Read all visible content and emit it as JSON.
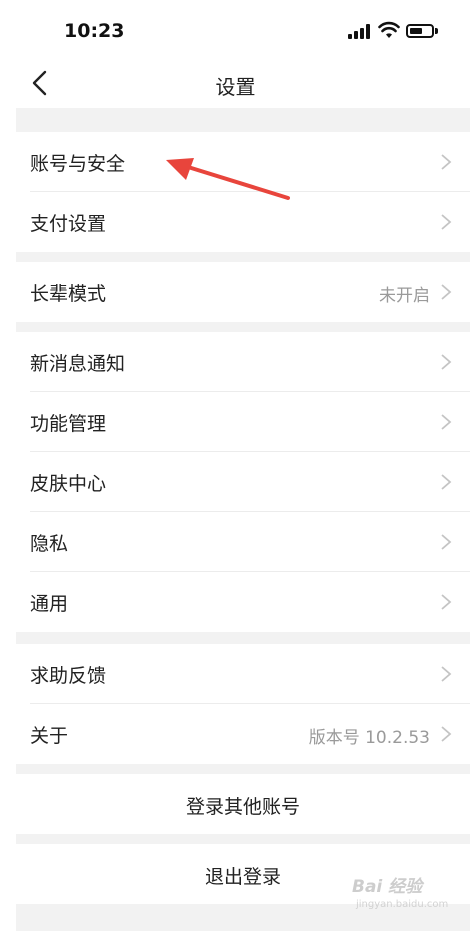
{
  "status_bar": {
    "time": "10:23"
  },
  "nav": {
    "title": "设置"
  },
  "groups": [
    {
      "items": [
        {
          "label": "账号与安全",
          "value": ""
        },
        {
          "label": "支付设置",
          "value": ""
        }
      ]
    },
    {
      "items": [
        {
          "label": "长辈模式",
          "value": "未开启"
        }
      ]
    },
    {
      "items": [
        {
          "label": "新消息通知",
          "value": ""
        },
        {
          "label": "功能管理",
          "value": ""
        },
        {
          "label": "皮肤中心",
          "value": ""
        },
        {
          "label": "隐私",
          "value": ""
        },
        {
          "label": "通用",
          "value": ""
        }
      ]
    },
    {
      "items": [
        {
          "label": "求助反馈",
          "value": ""
        },
        {
          "label": "关于",
          "value": "版本号 10.2.53"
        }
      ]
    }
  ],
  "actions": {
    "switch_account": "登录其他账号",
    "logout": "退出登录"
  },
  "colors": {
    "background_gap": "#f2f2f2",
    "annotation": "#e8453c",
    "secondary_text": "#9a9a9a"
  },
  "watermark": {
    "text": "Bai 经验",
    "sub": "jingyan.baidu.com"
  }
}
